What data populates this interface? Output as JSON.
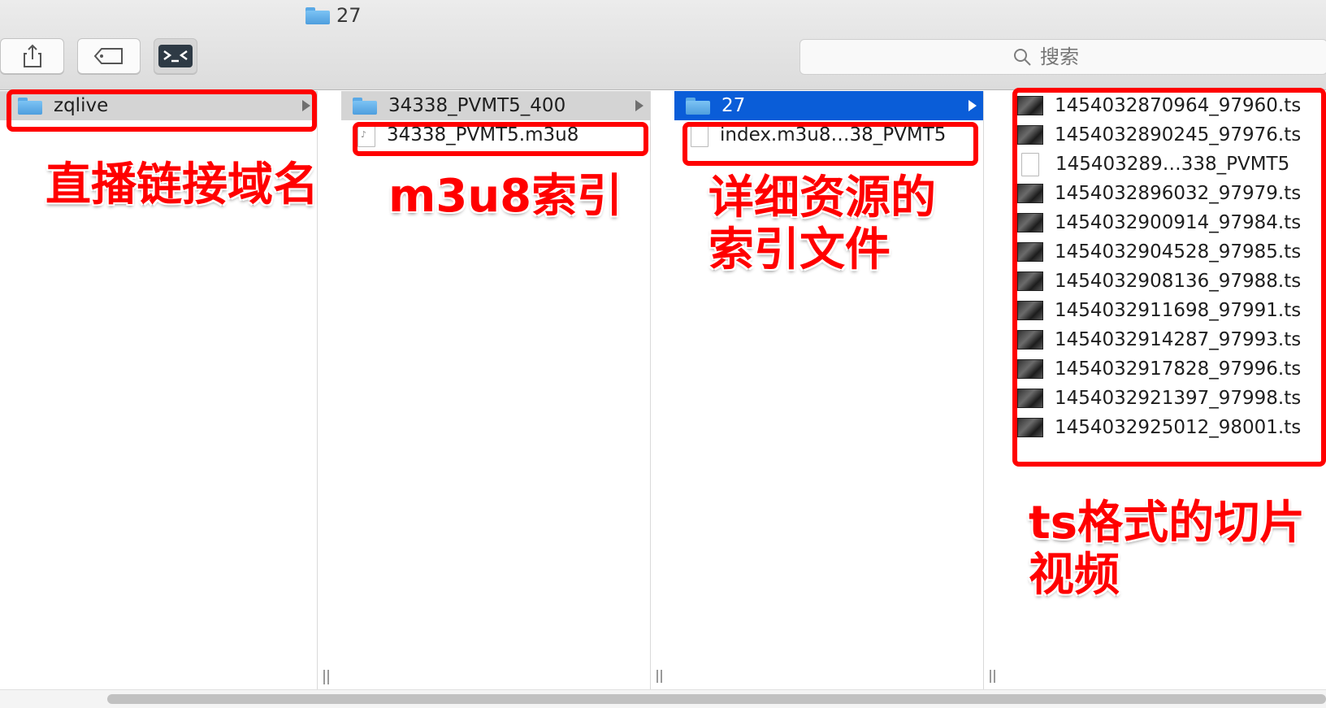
{
  "window": {
    "title": "27"
  },
  "toolbar": {
    "buttons": [
      {
        "name": "share-button",
        "icon": "share-icon"
      },
      {
        "name": "tags-button",
        "icon": "tag-icon"
      },
      {
        "name": "terminal-button",
        "icon": "terminal-icon"
      }
    ],
    "search_placeholder": "搜索"
  },
  "columns": [
    {
      "items": [
        {
          "label": "zqlive",
          "kind": "folder",
          "selected": "gray",
          "has_children": true
        }
      ]
    },
    {
      "items": [
        {
          "label": "34338_PVMT5_400",
          "kind": "folder",
          "selected": "gray",
          "has_children": true
        },
        {
          "label": "34338_PVMT5.m3u8",
          "kind": "m3u8"
        }
      ]
    },
    {
      "items": [
        {
          "label": "27",
          "kind": "folder",
          "selected": "blue",
          "has_children": true
        },
        {
          "label": "index.m3u8…38_PVMT5",
          "kind": "doc"
        }
      ]
    },
    {
      "items": [
        {
          "label": "1454032870964_97960.ts",
          "kind": "video"
        },
        {
          "label": "1454032890245_97976.ts",
          "kind": "video"
        },
        {
          "label": "145403289…338_PVMT5",
          "kind": "doc"
        },
        {
          "label": "1454032896032_97979.ts",
          "kind": "video"
        },
        {
          "label": "1454032900914_97984.ts",
          "kind": "video"
        },
        {
          "label": "1454032904528_97985.ts",
          "kind": "video"
        },
        {
          "label": "1454032908136_97988.ts",
          "kind": "video"
        },
        {
          "label": "1454032911698_97991.ts",
          "kind": "video"
        },
        {
          "label": "1454032914287_97993.ts",
          "kind": "video"
        },
        {
          "label": "1454032917828_97996.ts",
          "kind": "video"
        },
        {
          "label": "1454032921397_97998.ts",
          "kind": "video"
        },
        {
          "label": "1454032925012_98001.ts",
          "kind": "video"
        }
      ]
    }
  ],
  "annotations": {
    "domain": "直播链接域名",
    "m3u8": "m3u8索引",
    "detail_line1": "详细资源的",
    "detail_line2": "索引文件",
    "ts_line1": "ts格式的切片",
    "ts_line2": "视频"
  },
  "colors": {
    "selection_blue": "#0a5dd8",
    "annotation_red": "#ff0000"
  }
}
